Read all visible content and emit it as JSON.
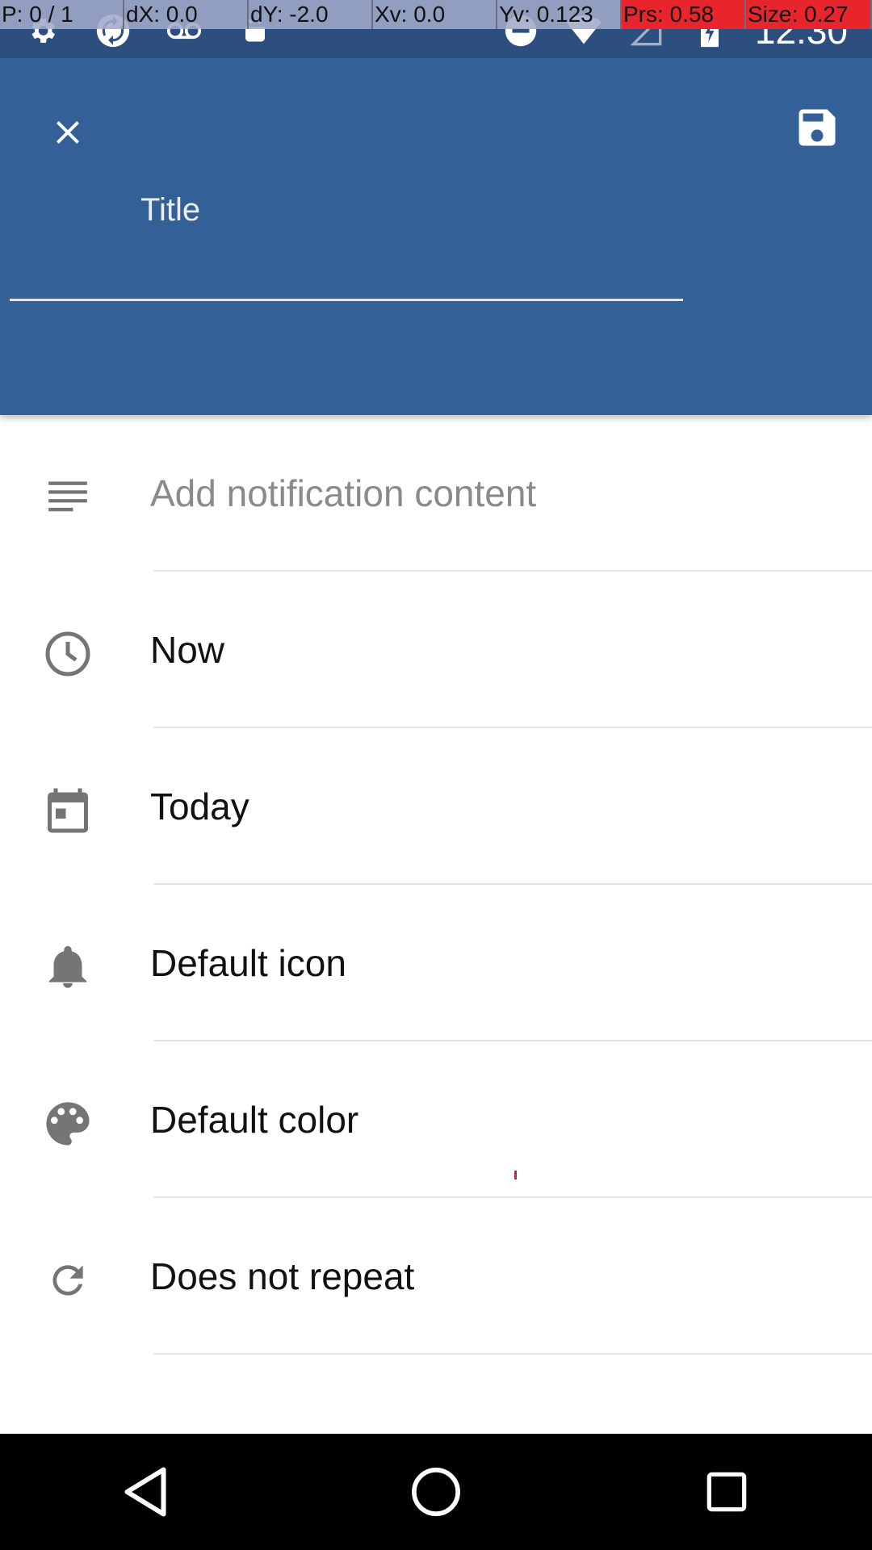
{
  "debug_overlay": {
    "pointer": "P: 0 / 1",
    "dx": "dX: 0.0",
    "dy": "dY: -2.0",
    "xv": "Xv: 0.0",
    "yv": "Yv: 0.123",
    "prs": "Prs: 0.58",
    "size": "Size: 0.27"
  },
  "status_bar": {
    "time": "12:30",
    "left_icons": [
      "settings-icon",
      "sync-icon",
      "voicemail-icon",
      "android-icon"
    ],
    "right_icons": [
      "do-not-disturb-icon",
      "wifi-icon",
      "signal-icon",
      "battery-charging-icon"
    ]
  },
  "header": {
    "title_placeholder": "Title",
    "close_icon": "close-icon",
    "save_icon": "save-icon"
  },
  "list": {
    "items": [
      {
        "icon": "notes-icon",
        "label": "Add notification content",
        "placeholder": true
      },
      {
        "icon": "clock-icon",
        "label": "Now"
      },
      {
        "icon": "calendar-icon",
        "label": "Today"
      },
      {
        "icon": "bell-icon",
        "label": "Default icon"
      },
      {
        "icon": "palette-icon",
        "label": "Default color"
      },
      {
        "icon": "repeat-icon",
        "label": "Does not repeat"
      }
    ]
  },
  "colors": {
    "header": "#336097",
    "status_bar": "#2c4f7f",
    "icon_gray": "#757575"
  },
  "nav_bar": {
    "buttons": [
      "back-icon",
      "home-icon",
      "recents-icon"
    ]
  }
}
